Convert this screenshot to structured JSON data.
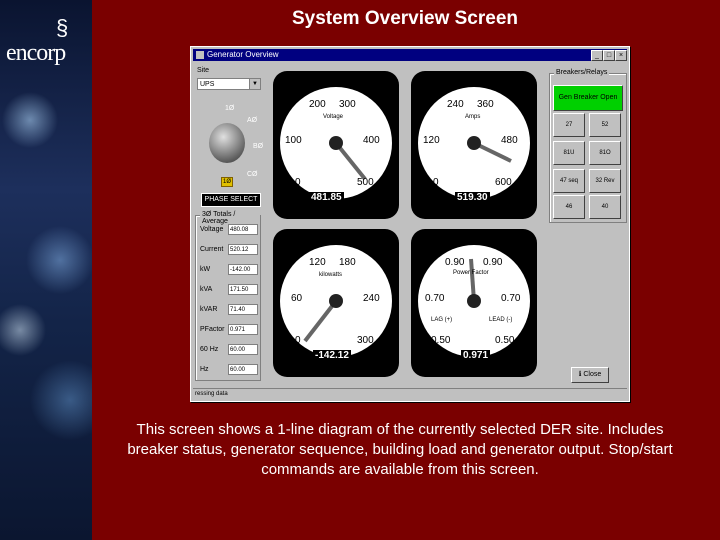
{
  "slide": {
    "title": "System Overview Screen",
    "caption": "This screen shows a 1-line diagram of the currently selected DER site. Includes breaker status, generator sequence, building load and generator output. Stop/start commands are available from this screen.",
    "logo_text": "encorp",
    "logo_glyph": "§"
  },
  "window": {
    "title": "Generator Overview",
    "buttons": {
      "minimize": "_",
      "maximize": "□",
      "close": "×"
    },
    "site_label": "Site",
    "site_value": "UPS",
    "status": "ressing data"
  },
  "selector": {
    "labels": {
      "h": "1Ø",
      "a": "AØ",
      "b": "BØ",
      "c": "CØ"
    },
    "lamp": "1Ø",
    "phase_button": "PHASE SELECT"
  },
  "totals": {
    "title": "3Ø Totals / Average",
    "rows": [
      {
        "label": "Voltage",
        "value": "480.08"
      },
      {
        "label": "Current",
        "value": "520.12"
      },
      {
        "label": "kW",
        "value": "-142.00"
      },
      {
        "label": "kVA",
        "value": "171.50"
      },
      {
        "label": "kVAR",
        "value": "71.40"
      },
      {
        "label": "PFactor",
        "value": "0.971"
      },
      {
        "label": "60 Hz",
        "value": "60.00"
      },
      {
        "label": "Hz",
        "value": "60.00"
      }
    ]
  },
  "gauges": [
    {
      "name": "voltage",
      "unit": "Voltage",
      "ticks": [
        "200",
        "300",
        "100",
        "400",
        "0",
        "500"
      ],
      "value": "481.85"
    },
    {
      "name": "amps",
      "unit": "Amps",
      "ticks": [
        "240",
        "360",
        "120",
        "480",
        "0",
        "600"
      ],
      "value": "519.30"
    },
    {
      "name": "kilowatts",
      "unit": "kilowatts",
      "ticks": [
        "120",
        "180",
        "60",
        "240",
        "0",
        "300"
      ],
      "value": "-142.12"
    },
    {
      "name": "power-factor",
      "unit": "Power Factor",
      "ticks": [
        "0.90",
        "0.90",
        "0.70",
        "0.70",
        "0.50",
        "0.50"
      ],
      "extra": [
        "LAG (+)",
        "LEAD (-)"
      ],
      "value": "0.971"
    }
  ],
  "breakers": {
    "title": "Breakers/Relays",
    "green": "Gen Breaker Open",
    "buttons": [
      "27",
      "52",
      "81U",
      "81O",
      "47 seq",
      "32 Rev",
      "46",
      "40"
    ]
  },
  "close_button": "Close",
  "colors": {
    "slide_bg": "#7a0000",
    "titlebar": "#000080",
    "green": "#00d000"
  }
}
